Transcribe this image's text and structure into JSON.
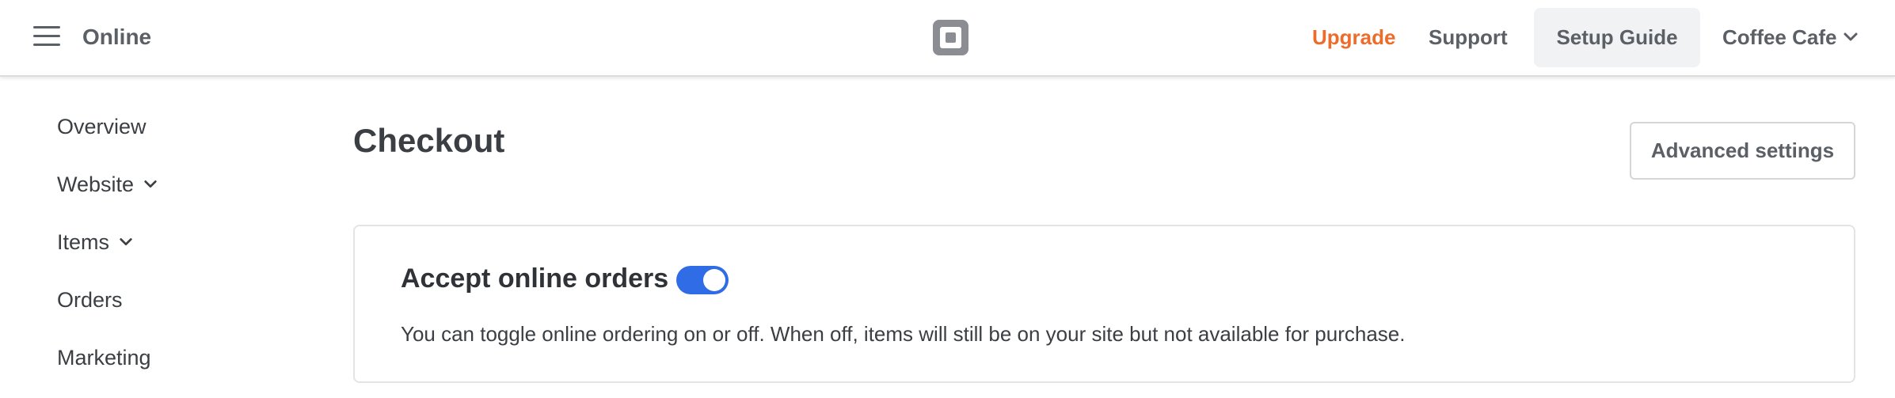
{
  "header": {
    "app_title": "Online",
    "menu_icon": "hamburger-menu-icon",
    "logo_icon": "square-logo-icon",
    "upgrade_label": "Upgrade",
    "support_label": "Support",
    "setup_guide_label": "Setup Guide",
    "account_name": "Coffee Cafe",
    "account_chevron_icon": "chevron-down-icon"
  },
  "sidebar": {
    "items": [
      {
        "label": "Overview"
      },
      {
        "label": "Website",
        "icon": "chevron-down-icon"
      },
      {
        "label": "Items",
        "icon": "chevron-down-icon"
      },
      {
        "label": "Orders"
      },
      {
        "label": "Marketing"
      }
    ]
  },
  "main": {
    "page_title": "Checkout",
    "advanced_settings_label": "Advanced settings",
    "card": {
      "title": "Accept online orders",
      "toggle_on": true,
      "description": "You can toggle online ordering on or off. When off, items will still be on your site but not available for purchase."
    }
  },
  "colors": {
    "accent": "#ee6c2b",
    "toggle": "#2f6ce5",
    "text": "#3b3f44",
    "muted": "#5b6066"
  }
}
